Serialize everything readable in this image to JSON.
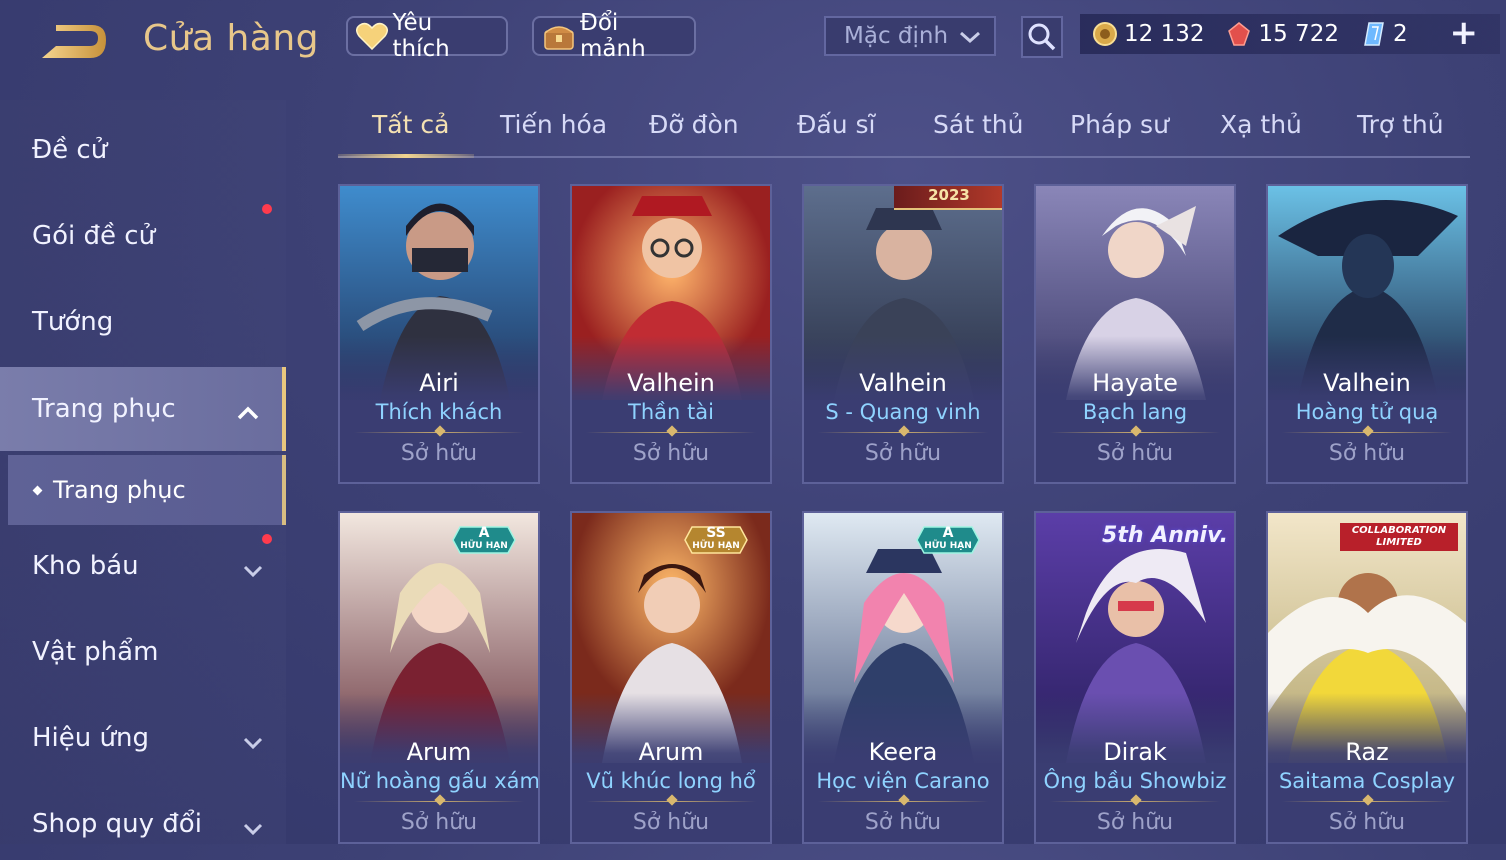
{
  "header": {
    "title": "Cửa hàng",
    "favorites_label": "Yêu thích",
    "exchange_label": "Đổi mảnh",
    "sort_value": "Mặc định"
  },
  "currency": {
    "gold": "12 132",
    "vouchers": "15 722",
    "diamonds": "2"
  },
  "sidebar": {
    "items": [
      {
        "label": "Đề cử"
      },
      {
        "label": "Gói đề cử"
      },
      {
        "label": "Tướng"
      },
      {
        "label": "Trang phục"
      },
      {
        "label": "Kho báu"
      },
      {
        "label": "Vật phẩm"
      },
      {
        "label": "Hiệu ứng"
      },
      {
        "label": "Shop quy đổi"
      }
    ],
    "sub_item": "Trang phục"
  },
  "tabs": [
    "Tất cả",
    "Tiến hóa",
    "Đỡ đòn",
    "Đấu sĩ",
    "Sát thủ",
    "Pháp sư",
    "Xạ thủ",
    "Trợ thủ"
  ],
  "cards": [
    {
      "hero": "Airi",
      "skin": "Thích khách",
      "status": "Sở hữu"
    },
    {
      "hero": "Valhein",
      "skin": "Thần tài",
      "status": "Sở hữu"
    },
    {
      "hero": "Valhein",
      "skin": "S - Quang vinh",
      "status": "Sở hữu",
      "banner": "2023"
    },
    {
      "hero": "Hayate",
      "skin": "Bạch lang",
      "status": "Sở hữu"
    },
    {
      "hero": "Valhein",
      "skin": "Hoàng tử quạ",
      "status": "Sở hữu"
    },
    {
      "hero": "Arum",
      "skin": "Nữ hoàng gấu xám",
      "status": "Sở hữu",
      "badge_grade": "A",
      "badge_text": "HỮU HẠN"
    },
    {
      "hero": "Arum",
      "skin": "Vũ khúc long hổ",
      "status": "Sở hữu",
      "badge_grade": "SS",
      "badge_text": "HỮU HẠN"
    },
    {
      "hero": "Keera",
      "skin": "Học viện Carano",
      "status": "Sở hữu",
      "badge_grade": "A",
      "badge_text": "HỮU HẠN"
    },
    {
      "hero": "Dirak",
      "skin": "Ông bầu Showbiz",
      "status": "Sở hữu",
      "banner": "5th Anniv."
    },
    {
      "hero": "Raz",
      "skin": "Saitama Cosplay",
      "status": "Sở hữu",
      "banner": "COLLABORATION LIMITED"
    }
  ],
  "colors": {
    "accent_gold": "#e8c78a",
    "skin_name": "#8fd3ff",
    "notification": "#ff3b4d"
  }
}
